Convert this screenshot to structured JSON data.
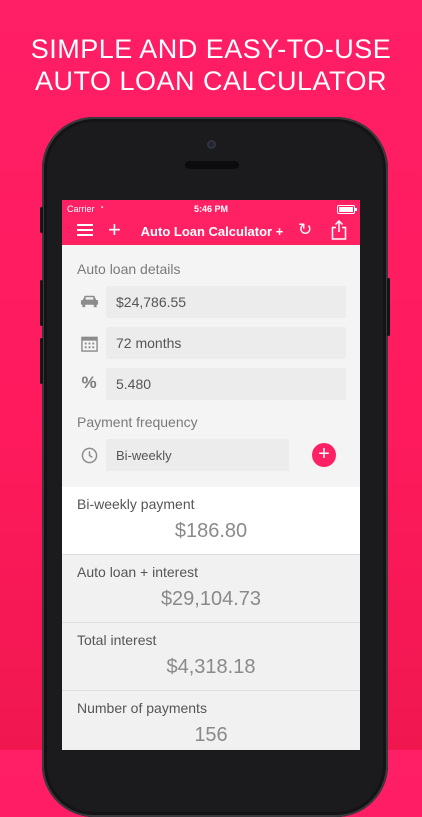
{
  "promo": {
    "line1": "SIMPLE AND EASY-TO-USE",
    "line2": "AUTO LOAN CALCULATOR"
  },
  "status_bar": {
    "carrier": "Carrier",
    "time": "5:46 PM"
  },
  "nav": {
    "title": "Auto Loan Calculator +"
  },
  "details": {
    "label": "Auto loan details",
    "amount": "$24,786.55",
    "term": "72 months",
    "rate_symbol": "%",
    "rate": "5.480"
  },
  "frequency": {
    "label": "Payment frequency",
    "value": "Bi-weekly"
  },
  "results": [
    {
      "label": "Bi-weekly payment",
      "value": "$186.80"
    },
    {
      "label": "Auto loan + interest",
      "value": "$29,104.73"
    },
    {
      "label": "Total interest",
      "value": "$4,318.18"
    },
    {
      "label": "Number of payments",
      "value": "156"
    }
  ],
  "colors": {
    "accent": "#ff2163",
    "background": "#ff1f66"
  },
  "icons": [
    "menu-icon",
    "plus-icon",
    "refresh-icon",
    "share-icon",
    "car-icon",
    "calendar-icon",
    "clock-icon",
    "add-icon"
  ]
}
